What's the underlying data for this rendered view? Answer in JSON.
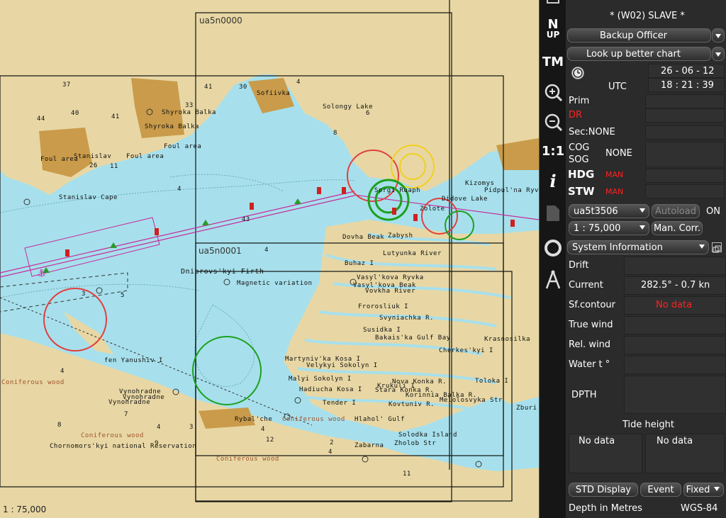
{
  "map": {
    "cell_a": "ua5n0000",
    "cell_b": "ua5n0001",
    "scale_label": "1 : 75,000",
    "labels": {
      "foul_area_1": "Foul area",
      "foul_area_2": "Foul area",
      "foul_area_3": "Foul area",
      "shyroka_1": "Shyroka Balka",
      "shyroka_2": "Shyroka Balka",
      "sofiivka": "Sofiivka",
      "solongy": "Solongy Lake",
      "stanislav": "Stanislav",
      "stanislav_cape": "Stanislav Cape",
      "dnipro_firth": "Dniprovs'kyi Firth",
      "mag_var": "Magnetic variation",
      "fen": "fen Yanushiv I",
      "vynohradne_1": "Vynohradne",
      "vynohradne_2": "Vynohradne",
      "vynohradne_3": "Vynohradne",
      "coniferous_1": "Coniferous wood",
      "coniferous_2": "Coniferous wood",
      "coniferous_3": "Coniferous wood",
      "coniferous_4": "Coniferous wood",
      "chornomor": "Chornomors'kyi national Reservation",
      "rybalche": "Rybal'che",
      "martyn": "Martyniv'ka Kosa I",
      "velykyi_sok": "Velykyi Sokolyn I",
      "malyi_sok": "Malyi Sokolyn I",
      "hadiucha": "Hadiucha Kosa I",
      "tender": "Tender I",
      "hlahol": "Hlahol' Gulf",
      "zabarna": "Zabarna",
      "solodka": "Solodka Island",
      "zholob": "Zholob Str",
      "kovtuniv": "Kovtuniv R.",
      "stara_konka": "Stara Konka R.",
      "nova_konka": "Nova Konka R.",
      "korinnia": "Korinnia Balka R.",
      "krukuli": "Krukuli I",
      "bakais": "Bakais'ka Gulf Bay",
      "susidka": "Susidka I",
      "svyniachka": "Svyniachka R.",
      "forosliuk": "Frorosliuk I",
      "vasylkova_1": "Vasyl'kova Ryvka",
      "vasylkova_2": "Vasyl'kova Beak",
      "vovkha": "Vovkha River",
      "lutunka": "Lutyunka River",
      "buhaz": "Buhaz I",
      "dovha": "Dovha Beak",
      "zabysh": "Zabysh",
      "sprgi": "Sprgi Ruaph",
      "kizomys": "Kizomys",
      "pidpul": "Pidpul'na Ryvka",
      "didove": "Didove Lake",
      "zolote": "Zolote",
      "cherkes": "Cherkes'kyi I",
      "tolokai": "Toloka I",
      "zburi": "Zburi",
      "krasnosilka": "Krasnosilka",
      "mahr": "Melolosvyka Str"
    },
    "depths": [
      "37",
      "40",
      "44",
      "41",
      "33",
      "41",
      "30",
      "4",
      "8",
      "6",
      "26",
      "11",
      "43",
      "4",
      "3",
      "5",
      "4",
      "7",
      "8",
      "4",
      "3",
      "4",
      "2",
      "12",
      "4",
      "11",
      "9",
      "4"
    ]
  },
  "toolbar": {
    "north_up_line1": "N",
    "north_up_line2": "UP",
    "tm_label": "TM",
    "one_to_one": "1:1",
    "info_label": "i"
  },
  "panel": {
    "title": "* (W02) SLAVE *",
    "backup_officer": "Backup Officer",
    "look_up_chart": "Look up better chart",
    "date": "26 - 06 - 12",
    "utc_label": "UTC",
    "time": "18 : 21 : 39",
    "prim_label": "Prim",
    "dr_label": "DR",
    "sec_label": "Sec:NONE",
    "cog_label": "COG",
    "sog_label": "SOG",
    "cog_sog_value": "NONE",
    "hdg_label": "HDG",
    "hdg_value": "MAN",
    "stw_label": "STW",
    "stw_value": "MAN",
    "chart_select": "ua5t3506",
    "autoload": "Autoload",
    "autoload_state": "ON",
    "scale_select": "1 : 75,000",
    "man_corr": "Man. Corr.",
    "info_select": "System Information",
    "drift_label": "Drift",
    "current_label": "Current",
    "current_value": "282.5° - 0.7 kn",
    "sf_contour_label": "Sf.contour",
    "sf_contour_value": "No data",
    "true_wind_label": "True wind",
    "rel_wind_label": "Rel. wind",
    "water_t_label": "Water t °",
    "dpth_label": "DPTH",
    "tide_height_label": "Tide height",
    "tide_left": "No data",
    "tide_right": "No data",
    "std_display": "STD Display",
    "event": "Event",
    "fixed": "Fixed",
    "depth_in_metres": "Depth in Metres",
    "datum": "WGS-84"
  },
  "colors": {
    "sea": "#a7e0ec",
    "land": "#e8d7a4",
    "built_up": "#c99b4a",
    "panel_bg": "#2b2b2b",
    "alert_red": "#ff2222"
  }
}
